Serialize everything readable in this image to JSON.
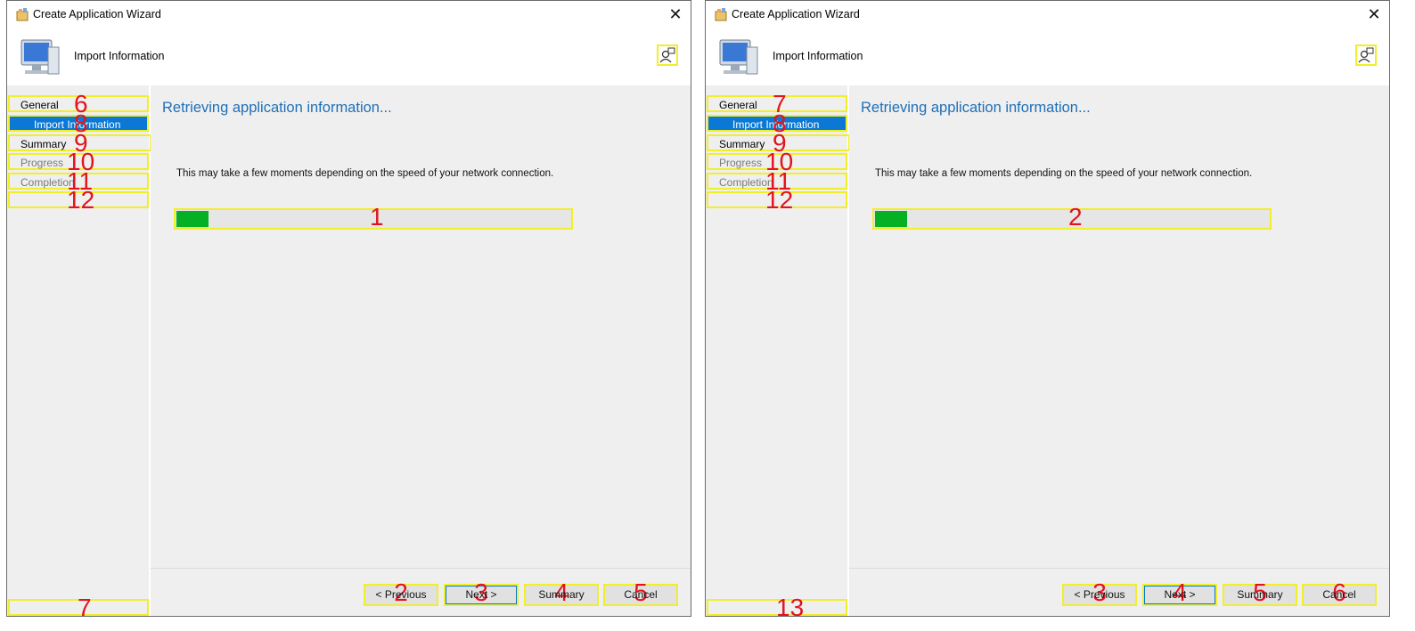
{
  "windows": [
    {
      "title": "Create Application Wizard",
      "close_glyph": "✕",
      "header_title": "Import Information",
      "nav": [
        {
          "label": "General",
          "num": "6"
        },
        {
          "label": "Import Information",
          "num": "8"
        },
        {
          "label": "Summary",
          "num": "9"
        },
        {
          "label": "Progress",
          "num": "10"
        },
        {
          "label": "Completion",
          "num": "11"
        },
        {
          "label": "",
          "num": "12"
        }
      ],
      "content_title": "Retrieving application information...",
      "info_text": "This may take a few moments depending on the speed of your network connection.",
      "progress": {
        "value_percent": 8,
        "num": "1"
      },
      "buttons": [
        {
          "label": "< Previous",
          "num": "2"
        },
        {
          "label": "Next >",
          "num": "3"
        },
        {
          "label": "Summary",
          "num": "4"
        },
        {
          "label": "Cancel",
          "num": "5"
        }
      ],
      "bottom_num": "7"
    },
    {
      "title": "Create Application Wizard",
      "close_glyph": "✕",
      "header_title": "Import Information",
      "nav": [
        {
          "label": "General",
          "num": "7"
        },
        {
          "label": "Import Information",
          "num": "8"
        },
        {
          "label": "Summary",
          "num": "9"
        },
        {
          "label": "Progress",
          "num": "10"
        },
        {
          "label": "Completion",
          "num": "11"
        },
        {
          "label": "",
          "num": "12"
        }
      ],
      "content_title": "Retrieving application information...",
      "info_text": "This may take a few moments depending on the speed of your network connection.",
      "progress": {
        "value_percent": 8,
        "num": "2"
      },
      "buttons": [
        {
          "label": "< Previous",
          "num": "3"
        },
        {
          "label": "Next >",
          "num": "4"
        },
        {
          "label": "Summary",
          "num": "5"
        },
        {
          "label": "Cancel",
          "num": "6"
        }
      ],
      "bottom_num": "13"
    }
  ],
  "colors": {
    "accent": "#0a78d4",
    "title_blue": "#1e6fb9",
    "progress_green": "#06b025",
    "annotation_yellow": "#f1ee2a",
    "annotation_red": "#e1141e"
  },
  "icons": {
    "app": "wizard-app-icon",
    "header": "computer-icon",
    "help": "help-person-icon",
    "close": "close-icon"
  }
}
